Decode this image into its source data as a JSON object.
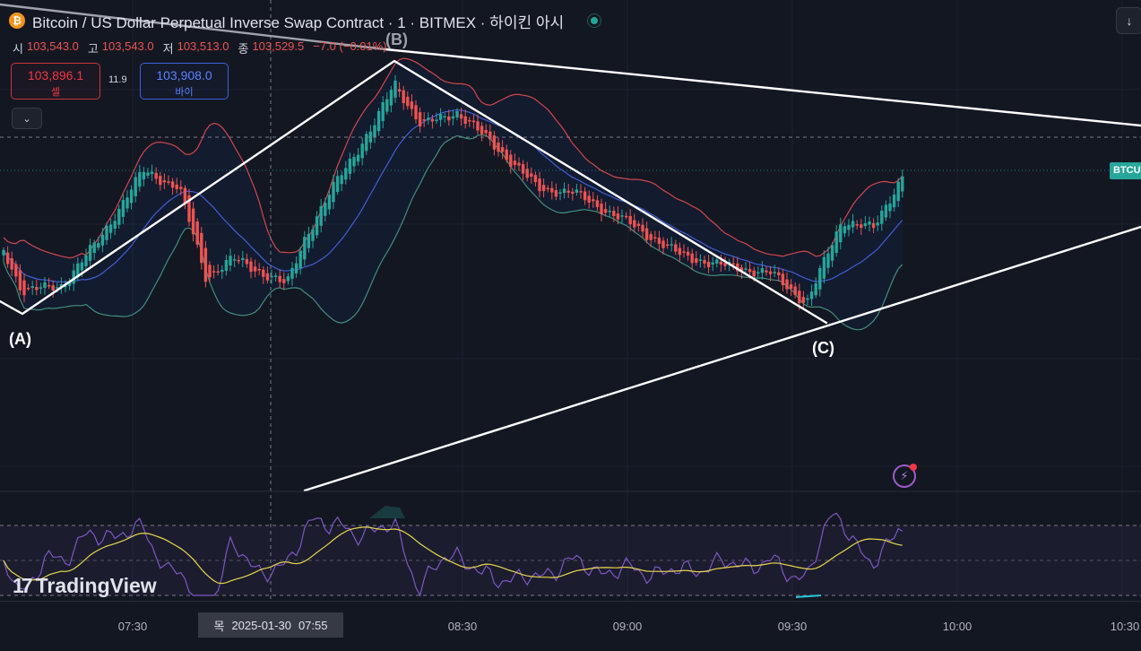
{
  "header": {
    "coin_glyph": "₿",
    "title": "Bitcoin / US Dollar Perpetual Inverse Swap Contract · 1 · BITMEX · 하이킨 아시"
  },
  "ohlc": {
    "open_label": "시",
    "open": "103,543.0",
    "high_label": "고",
    "high": "103,543.0",
    "low_label": "저",
    "low": "103,513.0",
    "close_label": "종",
    "close": "103,529.5",
    "change": "−7.0 (−0.01%)"
  },
  "trade": {
    "sell_price": "103,896.1",
    "sell_label": "셀",
    "spread": "11.9",
    "buy_price": "103,908.0",
    "buy_label": "바이"
  },
  "price_tag": "BTCUSD",
  "patterns": {
    "point_a": "(A)",
    "point_b": "(B)",
    "point_c": "(C)"
  },
  "brand": {
    "logo": "17",
    "name": "TradingView"
  },
  "time_axis": {
    "ticks": [
      "07:30",
      "08:30",
      "09:00",
      "09:30",
      "10:00",
      "10:30"
    ],
    "crosshair_day": "목",
    "crosshair_date": "2025-01-30",
    "crosshair_time": "07:55"
  },
  "icons": {
    "collapse": "chevron-down-icon",
    "scroll": "arrow-down-icon",
    "alert": "lightning-icon",
    "status": "live-dot-icon"
  },
  "colors": {
    "background": "#131722",
    "up": "#26a69a",
    "down": "#ef5350",
    "bb_upper": "#d0474b",
    "bb_lower": "#3f8f7c",
    "bb_basis": "#3f5fd6",
    "rsi": "#7e57c2",
    "rsi_ma": "#e8d84a",
    "trendline": "#ffffff"
  }
}
